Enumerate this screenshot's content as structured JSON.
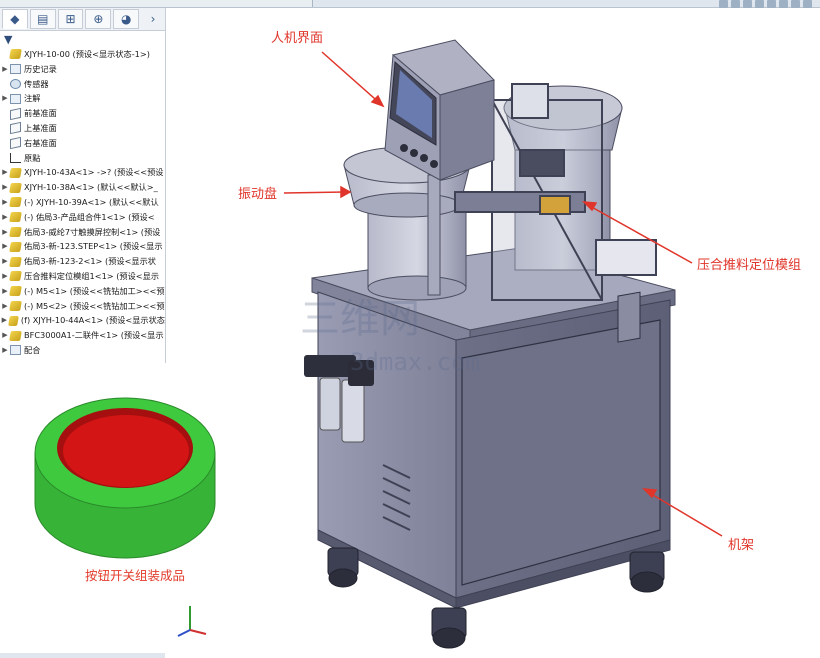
{
  "feature_tree": {
    "items": [
      {
        "label": "XJYH-10-00  (预设<显示状态-1>)",
        "icon": "assembly-icon",
        "arrow": ""
      },
      {
        "label": "历史记录",
        "icon": "history-icon",
        "arrow": "▶"
      },
      {
        "label": "传感器",
        "icon": "sensor-icon",
        "arrow": ""
      },
      {
        "label": "注解",
        "icon": "annotation-icon",
        "arrow": "▶"
      },
      {
        "label": "前基准面",
        "icon": "plane-icon",
        "arrow": ""
      },
      {
        "label": "上基准面",
        "icon": "plane-icon",
        "arrow": ""
      },
      {
        "label": "右基准面",
        "icon": "plane-icon",
        "arrow": ""
      },
      {
        "label": "原點",
        "icon": "origin-icon",
        "arrow": ""
      },
      {
        "label": "XJYH-10-43A<1> ->? (预设<<预设",
        "icon": "part-icon",
        "arrow": "▶"
      },
      {
        "label": "XJYH-10-38A<1> (默认<<默认>_",
        "icon": "part-icon",
        "arrow": "▶"
      },
      {
        "label": "(-) XJYH-10-39A<1> (默认<<默认",
        "icon": "part-icon",
        "arrow": "▶"
      },
      {
        "label": "(-) 佑局3-产品组合件1<1> (预设<",
        "icon": "part-icon",
        "arrow": "▶"
      },
      {
        "label": "佑局3-威纶7寸触摸屏控制<1> (预设",
        "icon": "part-icon",
        "arrow": "▶"
      },
      {
        "label": "佑局3-新-123.STEP<1> (预设<显示",
        "icon": "part-icon",
        "arrow": "▶"
      },
      {
        "label": "佑局3-新-123-2<1> (预设<显示状",
        "icon": "part-icon",
        "arrow": "▶"
      },
      {
        "label": "压合推料定位模组1<1> (预设<显示",
        "icon": "part-icon",
        "arrow": "▶"
      },
      {
        "label": "(-) M5<1> (预设<<铣钻加工><<预",
        "icon": "part-icon",
        "arrow": "▶"
      },
      {
        "label": "(-) M5<2> (预设<<铣钻加工><<预",
        "icon": "part-icon",
        "arrow": "▶"
      },
      {
        "label": "(f) XJYH-10-44A<1> (预设<显示状态",
        "icon": "part-icon",
        "arrow": "▶"
      },
      {
        "label": "BFC3000A1-二联件<1> (预设<显示",
        "icon": "part-icon",
        "arrow": "▶"
      },
      {
        "label": "配合",
        "icon": "mates-icon",
        "arrow": "▶"
      }
    ]
  },
  "callouts": {
    "hmi": "人机界面",
    "vibratory_bowl": "振动盘",
    "press_module": "压合推料定位模组",
    "frame": "机架"
  },
  "inset": {
    "caption": "按钮开关组装成品"
  },
  "watermark": {
    "text": "3dmax.com",
    "logo": "三维网"
  },
  "colors": {
    "callout": "#e0352a",
    "cabinet": "#8d8fa6",
    "button_green": "#3cc83c",
    "button_red": "#d41515"
  }
}
